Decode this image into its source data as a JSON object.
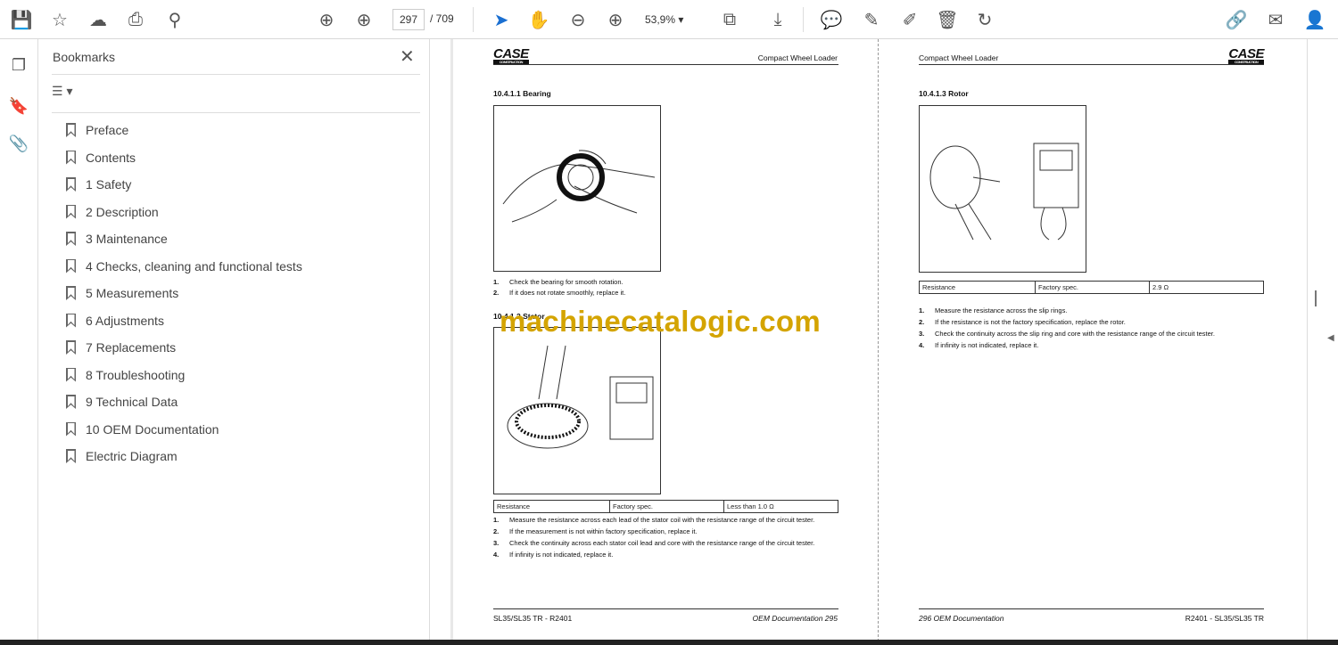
{
  "toolbar": {
    "page_current": "297",
    "page_total": "/ 709",
    "zoom": "53,9%"
  },
  "bookmarks": {
    "title": "Bookmarks",
    "items": [
      "Preface",
      "Contents",
      "1 Safety",
      "2 Description",
      "3 Maintenance",
      "4 Checks, cleaning and functional tests",
      "5 Measurements",
      "6 Adjustments",
      "7 Replacements",
      "8 Troubleshooting",
      "9 Technical Data",
      "10 OEM Documentation",
      "Electric Diagram"
    ]
  },
  "left_page": {
    "logo": "CASE",
    "logo_sub": "CONSTRUCTION",
    "header": "Compact Wheel Loader",
    "sec1": "10.4.1.1    Bearing",
    "steps1": [
      [
        "1.",
        "Check the bearing for smooth rotation."
      ],
      [
        "2.",
        "If it does not rotate smoothly, replace it."
      ]
    ],
    "sec2": "10.4.1.2    Stator",
    "spec": [
      "Resistance",
      "Factory spec.",
      "Less than 1.0 Ω"
    ],
    "steps2": [
      [
        "1.",
        "Measure the resistance across each lead of the stator coil with the resistance range of the circuit tester."
      ],
      [
        "2.",
        "If the measurement is not within factory specification, replace it."
      ],
      [
        "3.",
        "Check the continuity across each stator coil lead and core with the resistance range of the circuit tester."
      ],
      [
        "4.",
        "If infinity is not indicated, replace it."
      ]
    ],
    "footer_left": "SL35/SL35 TR -  R2401",
    "footer_right": "OEM Documentation   295"
  },
  "right_page": {
    "logo": "CASE",
    "logo_sub": "CONSTRUCTION",
    "header": "Compact Wheel Loader",
    "sec": "10.4.1.3    Rotor",
    "spec": [
      "Resistance",
      "Factory spec.",
      "2.9 Ω"
    ],
    "steps": [
      [
        "1.",
        "Measure the resistance across the slip rings."
      ],
      [
        "2.",
        "If the resistance is not the factory specification, replace the rotor."
      ],
      [
        "3.",
        "Check the continuity across the slip ring and core with the resistance range of the circuit tester."
      ],
      [
        "4.",
        "If infinity is not indicated, replace it."
      ]
    ],
    "footer_left": "296   OEM Documentation",
    "footer_right": "R2401  - SL35/SL35 TR"
  },
  "watermark": "machinecatalogic.com"
}
